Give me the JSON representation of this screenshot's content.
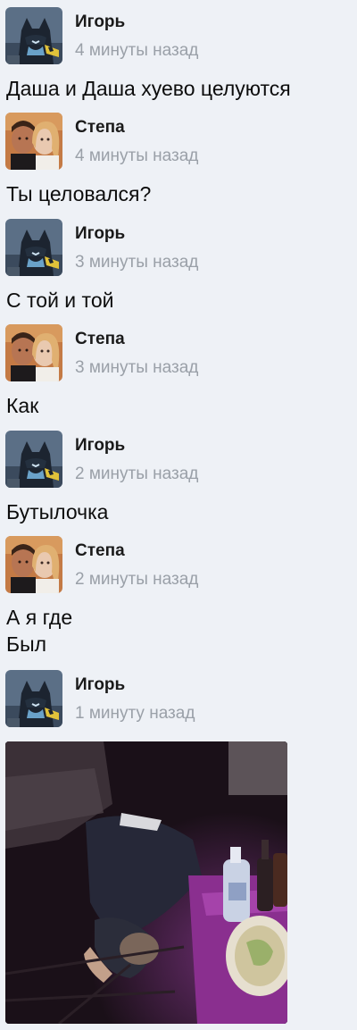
{
  "messages": [
    {
      "author": "Игорь",
      "avatar": "batman-avatar",
      "time": "4 минуты назад",
      "text": "Даша и Даша хуево целуются"
    },
    {
      "author": "Степа",
      "avatar": "couple-photo-avatar",
      "time": "4 минуты назад",
      "text": "Ты целовался?"
    },
    {
      "author": "Игорь",
      "avatar": "batman-avatar",
      "time": "3 минуты назад",
      "text": "С той и той"
    },
    {
      "author": "Степа",
      "avatar": "couple-photo-avatar",
      "time": "3 минуты назад",
      "text": "Как"
    },
    {
      "author": "Игорь",
      "avatar": "batman-avatar",
      "time": "2 минуты назад",
      "text": "Бутылочка"
    },
    {
      "author": "Степа",
      "avatar": "couple-photo-avatar",
      "time": "2 минуты назад",
      "text": "А я где\nБыл"
    },
    {
      "author": "Игорь",
      "avatar": "batman-avatar",
      "time": "1 минуту назад",
      "attachment": "photo-person-on-floor"
    }
  ],
  "colors": {
    "background": "#eef1f6",
    "timestamp": "#9aa0a8",
    "name": "#1a1a1a"
  }
}
